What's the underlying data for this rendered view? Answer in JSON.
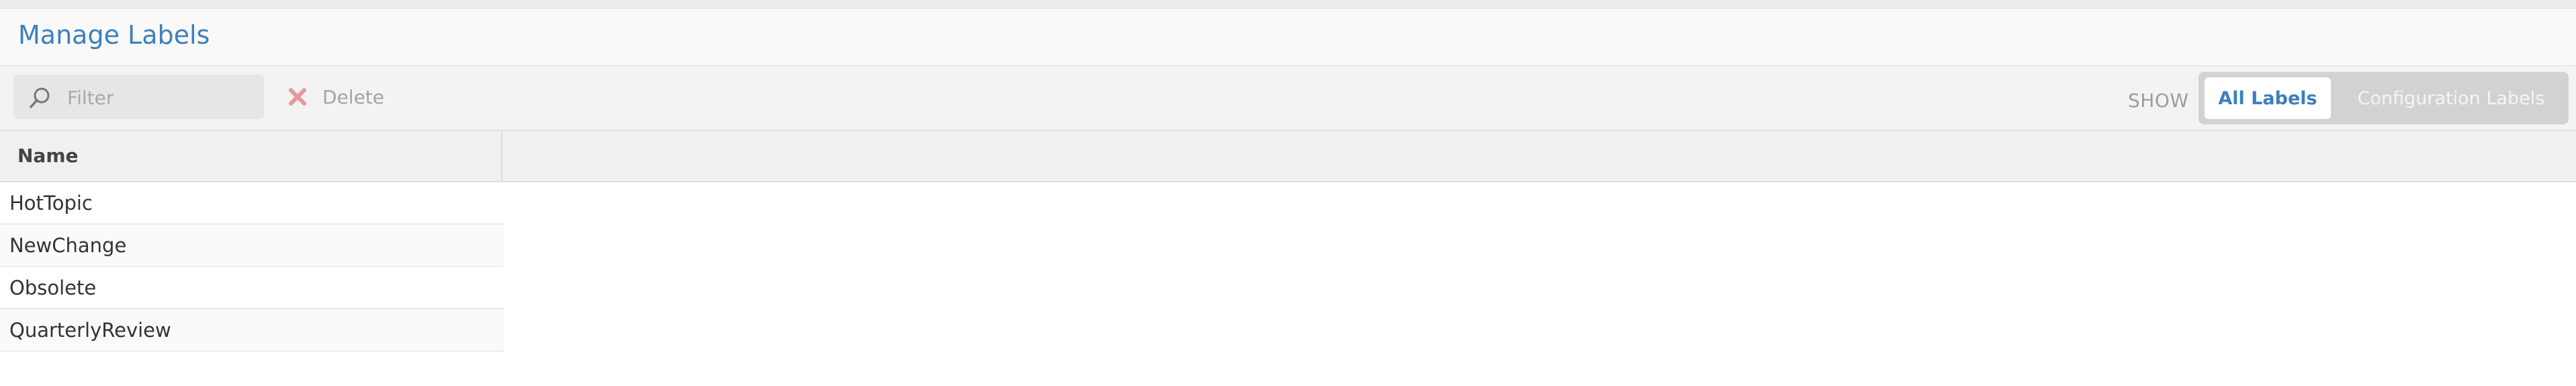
{
  "page": {
    "title": "Manage Labels"
  },
  "toolbar": {
    "filter_placeholder": "Filter",
    "delete_label": "Delete",
    "show_label": "SHOW",
    "view_options": [
      "All Labels",
      "Configuration Labels"
    ],
    "selected_view": "All Labels"
  },
  "table": {
    "columns": [
      "Name"
    ],
    "rows": [
      "HotTopic",
      "NewChange",
      "Obsolete",
      "QuarterlyReview"
    ]
  },
  "colors": {
    "accent": "#3d7fbd",
    "delete_icon": "#e29a9a"
  },
  "icons": {
    "filter": "search-icon",
    "delete": "close-icon"
  }
}
